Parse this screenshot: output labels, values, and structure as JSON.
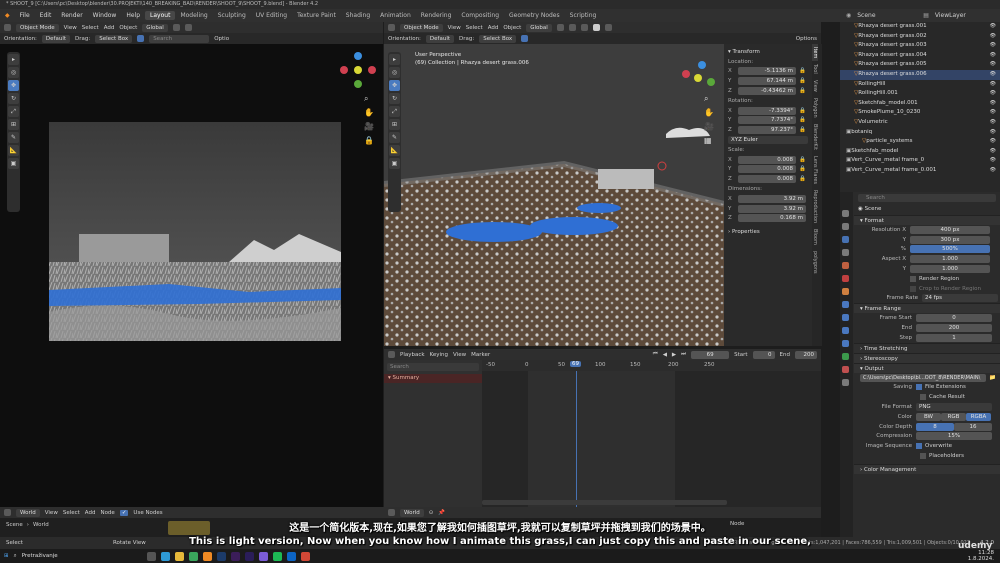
{
  "window": {
    "title": "* SHOOT_9 [C:\\Users\\pc\\Desktop\\blender\\30.PROJEKTI\\140_BREAKING_BAD\\RENDER\\SHOOT_9\\SHOOT_9.blend] - Blender 4.2"
  },
  "menu": [
    "File",
    "Edit",
    "Render",
    "Window",
    "Help"
  ],
  "workspaces": [
    "Layout",
    "Modeling",
    "Sculpting",
    "UV Editing",
    "Texture Paint",
    "Shading",
    "Animation",
    "Rendering",
    "Compositing",
    "Geometry Nodes",
    "Scripting"
  ],
  "top_right": {
    "scene": "Scene",
    "view_layer": "ViewLayer"
  },
  "left_view": {
    "mode": "Object Mode",
    "menus": [
      "View",
      "Select",
      "Add",
      "Object"
    ],
    "orientation_label": "Orientation:",
    "orientation": "Default",
    "drag_label": "Drag:",
    "drag": "Select Box",
    "transform": "Global",
    "search_ph": "Search",
    "options": "Optio"
  },
  "main_view": {
    "mode": "Object Mode",
    "menus": [
      "View",
      "Select",
      "Add",
      "Object"
    ],
    "transform": "Global",
    "orientation_label": "Orientation:",
    "orientation": "Default",
    "drag_label": "Drag:",
    "drag": "Select Box",
    "options": "Options",
    "perspective": "User Perspective",
    "collection": "(69) Collection | Rhazya desert grass.006"
  },
  "npanel": {
    "tabs": [
      "Item",
      "Tool",
      "View",
      "Polygon",
      "BlenderKit",
      "Lens Flares",
      "Reproduction",
      "Bloom",
      "polygons"
    ],
    "transform": "Transform",
    "location_label": "Location:",
    "location": [
      "-5.1136 m",
      "67.144 m",
      "-0.43462 m"
    ],
    "rotation_label": "Rotation:",
    "rotation": [
      "-7.3394°",
      "7.7374°",
      "97.237°"
    ],
    "rotation_mode": "XYZ Euler",
    "scale_label": "Scale:",
    "scale": [
      "0.008",
      "0.008",
      "0.008"
    ],
    "dimensions_label": "Dimensions:",
    "dimensions": [
      "3.92 m",
      "3.92 m",
      "0.168 m"
    ],
    "axes": [
      "X",
      "Y",
      "Z"
    ],
    "properties": "Properties"
  },
  "outliner": {
    "items": [
      {
        "name": "Rhazya desert grass.001",
        "indent": 1
      },
      {
        "name": "Rhazya desert grass.002",
        "indent": 1
      },
      {
        "name": "Rhazya desert grass.003",
        "indent": 1
      },
      {
        "name": "Rhazya desert grass.004",
        "indent": 1
      },
      {
        "name": "Rhazya desert grass.005",
        "indent": 1
      },
      {
        "name": "Rhazya desert grass.006",
        "indent": 1
      },
      {
        "name": "RollingHill",
        "indent": 1
      },
      {
        "name": "RollingHill.001",
        "indent": 1
      },
      {
        "name": "Sketchfab_model.001",
        "indent": 1
      },
      {
        "name": "SmokePlume_10_0230",
        "indent": 1
      },
      {
        "name": "Volumetric",
        "indent": 1
      },
      {
        "name": "botaniq",
        "indent": 0
      },
      {
        "name": "particle_systems",
        "indent": 2
      },
      {
        "name": "Sketchfab_model",
        "indent": 0
      },
      {
        "name": "Vert_Curve_metal frame_0",
        "indent": 0
      },
      {
        "name": "Vert_Curve_metal frame_0.001",
        "indent": 0
      }
    ]
  },
  "props": {
    "search_ph": "Search",
    "scene": "Scene",
    "format": "Format",
    "res_x_label": "Resolution X",
    "res_x": "400 px",
    "res_y_label": "Y",
    "res_y": "300 px",
    "pct_label": "%",
    "pct": "500%",
    "aspect_x_label": "Aspect X",
    "aspect_x": "1.000",
    "aspect_y_label": "Y",
    "aspect_y": "1.000",
    "render_region": "Render Region",
    "crop": "Crop to Render Region",
    "frame_rate_label": "Frame Rate",
    "frame_rate": "24 fps",
    "frame_range": "Frame Range",
    "frame_start_label": "Frame Start",
    "frame_start": "0",
    "end_label": "End",
    "end": "200",
    "step_label": "Step",
    "step": "1",
    "time_stretching": "Time Stretching",
    "stereoscopy": "Stereoscopy",
    "output": "Output",
    "output_path": "C:\\Users\\pc\\Desktop\\bl...OOT_8\\RENDER\\MAIN\\",
    "saving_label": "Saving",
    "file_ext": "File Extensions",
    "cache": "Cache Result",
    "file_format_label": "File Format",
    "file_format": "PNG",
    "color_label": "Color",
    "color_opts": [
      "BW",
      "RGB",
      "RGBA"
    ],
    "depth_label": "Color Depth",
    "depth_opts": [
      "8",
      "16"
    ],
    "compression_label": "Compression",
    "compression": "15%",
    "img_seq_label": "Image Sequence",
    "overwrite": "Overwrite",
    "placeholders": "Placeholders",
    "color_mgmt": "Color Management"
  },
  "timeline": {
    "menus": [
      "Playback",
      "Keying",
      "View",
      "Marker"
    ],
    "current": "69",
    "start_label": "Start",
    "start": "0",
    "end_label": "End",
    "end": "200",
    "search_ph": "Search",
    "summary": "Summary",
    "ticks": [
      "-50",
      "0",
      "50",
      "69",
      "100",
      "150",
      "200",
      "250"
    ]
  },
  "node_editor": {
    "world": "World",
    "menus": [
      "View",
      "Select",
      "Add",
      "Node"
    ],
    "use_nodes": "Use Nodes",
    "world2": "World",
    "breadcrumb": [
      "Scene",
      "World"
    ],
    "node_label": "Node",
    "options": "Options"
  },
  "status": {
    "select": "Select",
    "rotate": "Rotate View",
    "obj": "Obje",
    "stats": "Collection | Rhazya desert grass.006 | Verts:1,047,201 | Faces:786,559 | Tris:1,009,501 | Objects:0/10,027",
    "version": "4.2.0"
  },
  "taskbar": {
    "search": "Pretraživanje",
    "time": "11:28",
    "date": "1.8.2024."
  },
  "subtitles": {
    "zh": "这是一个简化版本,现在,如果您了解我如何插图草坪,我就可以复制草坪并拖拽到我们的场景中。",
    "en": "This is light version, Now when you know how I animate this grass,I can just copy this and paste in our scene,"
  },
  "watermark": "udemy",
  "colors": {
    "accent": "#4772b3",
    "water": "#2f6fd4",
    "selection": "#f0a030"
  }
}
